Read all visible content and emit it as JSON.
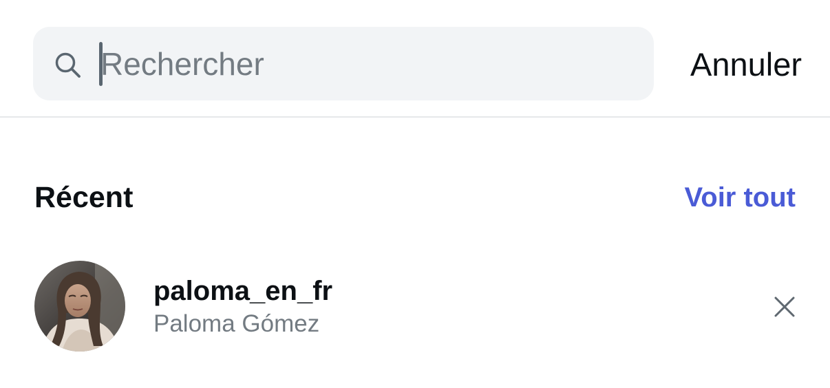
{
  "search": {
    "placeholder": "Rechercher",
    "value": "",
    "icon": "search-icon"
  },
  "header": {
    "cancel_label": "Annuler"
  },
  "recent": {
    "title": "Récent",
    "see_all_label": "Voir tout",
    "items": [
      {
        "username": "paloma_en_fr",
        "full_name": "Paloma Gómez",
        "avatar": "profile-photo",
        "remove_icon": "close-icon"
      }
    ]
  },
  "colors": {
    "link": "#4a5bd6",
    "search_background": "#f2f4f6",
    "secondary_text": "#737b82",
    "primary_text": "#0c1014"
  }
}
